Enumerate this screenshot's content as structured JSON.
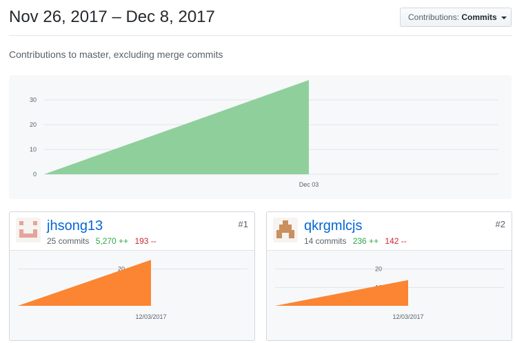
{
  "header": {
    "date_range": "Nov 26, 2017 – Dec 8, 2017",
    "contributions_button": {
      "label": "Contributions:",
      "value": "Commits"
    }
  },
  "subtitle": "Contributions to master, excluding merge commits",
  "colors": {
    "main_area": "#8fcf9c",
    "contributor_area": "#fb8532",
    "link": "#0366d6",
    "additions": "#28a745",
    "deletions": "#cb2431"
  },
  "chart_data": [
    {
      "type": "area",
      "x": [
        "Nov 26, 2017",
        "Dec 03, 2017"
      ],
      "y": [
        0,
        38
      ],
      "x_tick_labels": [
        "Dec 03"
      ],
      "y_ticks": [
        0,
        10,
        20,
        30
      ],
      "ylim": [
        0,
        40
      ],
      "grid": true
    },
    {
      "type": "area",
      "x": [
        "11/26/2017",
        "12/03/2017"
      ],
      "y": [
        0,
        25
      ],
      "x_tick_labels": [
        "12/03/2017"
      ],
      "y_ticks": [
        20
      ],
      "grid": true
    },
    {
      "type": "area",
      "x": [
        "11/26/2017",
        "12/03/2017"
      ],
      "y": [
        0,
        14
      ],
      "x_tick_labels": [
        "12/03/2017"
      ],
      "y_ticks": [
        10,
        20
      ],
      "grid": true
    }
  ],
  "contributors": [
    {
      "rank": "#1",
      "username": "jhsong13",
      "commits": "25 commits",
      "additions": "5,270 ++",
      "deletions": "193 --",
      "avatar_icon": "identicon-avatar-icon"
    },
    {
      "rank": "#2",
      "username": "qkrgmlcjs",
      "commits": "14 commits",
      "additions": "236 ++",
      "deletions": "142 --",
      "avatar_icon": "identicon-avatar-icon"
    }
  ]
}
